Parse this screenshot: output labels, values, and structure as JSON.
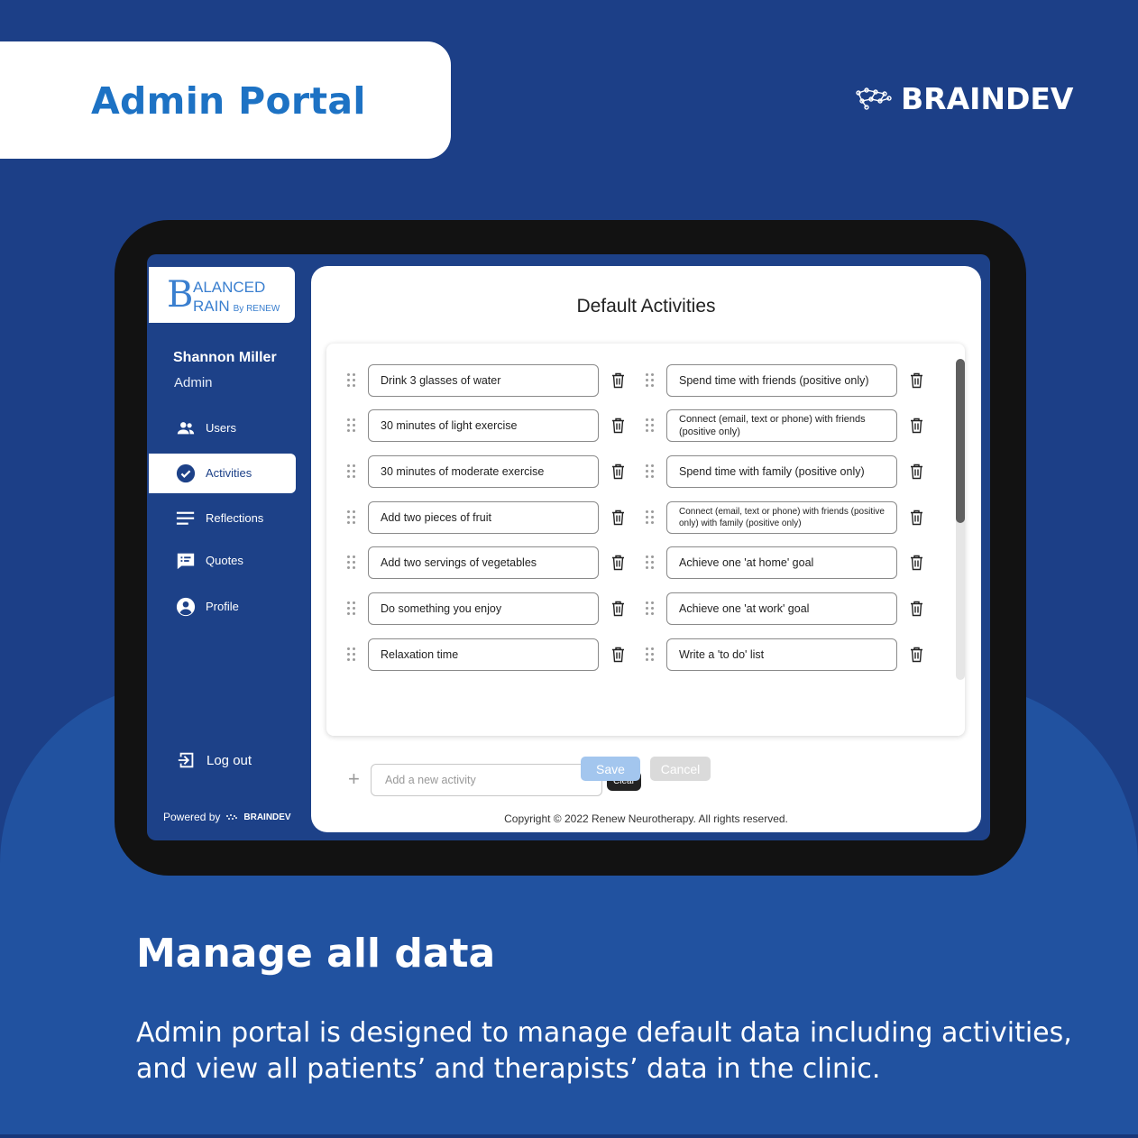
{
  "header": {
    "title": "Admin Portal",
    "brand_name": "BRAINDEV",
    "brand_icon": "braindev-logo-icon"
  },
  "app": {
    "logo": {
      "line1": "ALANCED",
      "line2": "RAIN",
      "byline": "By RENEW"
    },
    "user": {
      "name": "Shannon Miller",
      "role": "Admin"
    },
    "nav": [
      {
        "label": "Users",
        "icon": "users-icon",
        "active": false
      },
      {
        "label": "Activities",
        "icon": "check-circle-icon",
        "active": true
      },
      {
        "label": "Reflections",
        "icon": "lines-icon",
        "active": false
      },
      {
        "label": "Quotes",
        "icon": "quote-icon",
        "active": false
      },
      {
        "label": "Profile",
        "icon": "profile-icon",
        "active": false
      }
    ],
    "logout_label": "Log out",
    "powered_by": "Powered by",
    "powered_brand": "BRAINDEV"
  },
  "main": {
    "title": "Default Activities",
    "left_activities": [
      "Drink 3 glasses of water",
      "30 minutes of light exercise",
      "30 minutes of moderate exercise",
      "Add two pieces of fruit",
      "Add two servings of vegetables",
      "Do something you enjoy",
      "Relaxation time"
    ],
    "right_activities": [
      "Spend time with friends (positive only)",
      "Connect (email, text or phone) with friends (positive only)",
      "Spend time with family (positive only)",
      "Connect (email, text or phone) with friends (positive only) with family (positive only)",
      "Achieve one 'at home' goal",
      "Achieve one 'at work' goal",
      "Write a 'to do' list"
    ],
    "add_placeholder": "Add a new activity",
    "clear_label": "Clear",
    "save_label": "Save",
    "cancel_label": "Cancel",
    "copyright": "Copyright © 2022 Renew Neurotherapy. All rights reserved."
  },
  "footer": {
    "headline": "Manage all data",
    "line1": "Admin portal is designed to manage default data including activities,",
    "line2": "and view all patients’ and therapists’ data in the clinic."
  },
  "colors": {
    "background": "#1c3f87",
    "accent_blue": "#1d72c4",
    "sidebar": "#1d4188",
    "save_button": "#a3c6ee"
  }
}
